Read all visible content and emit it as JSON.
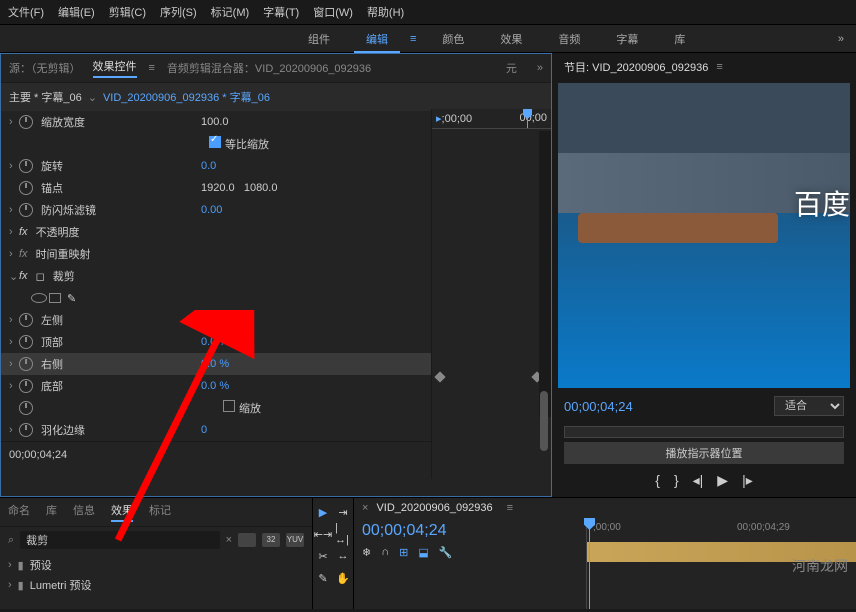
{
  "menu": {
    "file": "文件(F)",
    "edit": "编辑(E)",
    "clip": "剪辑(C)",
    "sequence": "序列(S)",
    "mark": "标记(M)",
    "subtitle": "字幕(T)",
    "window": "窗口(W)",
    "help": "帮助(H)"
  },
  "tabs": {
    "component": "组件",
    "edit": "编辑",
    "color": "颜色",
    "effect": "效果",
    "audio": "音频",
    "subtitle": "字幕",
    "library": "库",
    "more": "»"
  },
  "source_tabs": {
    "source": "源：（无剪辑）",
    "effect_controls": "效果控件",
    "audio_mixer": "音频剪辑混合器：VID_20200906_092936",
    "yuan": "元",
    "more": "»"
  },
  "breadcrumb": {
    "main": "主要 * 字幕_06",
    "clip": "VID_20200906_092936 * 字幕_06"
  },
  "timeline_head": {
    "start": ";00;00",
    "end": "00;00"
  },
  "props": {
    "scale_width": {
      "label": "缩放宽度",
      "value": "100.0"
    },
    "uniform": {
      "label": "等比缩放"
    },
    "rotation": {
      "label": "旋转",
      "value": "0.0"
    },
    "anchor": {
      "label": "锚点",
      "x": "1920.0",
      "y": "1080.0"
    },
    "flicker": {
      "label": "防闪烁滤镜",
      "value": "0.00"
    },
    "opacity": {
      "label": "不透明度"
    },
    "time_remap": {
      "label": "时间重映射"
    },
    "crop": {
      "label": "裁剪"
    },
    "left": {
      "label": "左侧",
      "value": "0.0 %"
    },
    "top": {
      "label": "顶部",
      "value": "0.0 %"
    },
    "right": {
      "label": "右侧",
      "value": "0.0 %"
    },
    "bottom": {
      "label": "底部",
      "value": "0.0 %"
    },
    "zoom": {
      "label": "缩放"
    },
    "feather": {
      "label": "羽化边缘",
      "value": "0"
    }
  },
  "reset_icon": "↺",
  "timecode": "00;00;04;24",
  "program": {
    "label": "节目: VID_20200906_092936",
    "overlay": "百度",
    "tc": "00;00;04;24",
    "fit": "适合",
    "scrub_label": "播放指示器位置"
  },
  "bottom_tabs": {
    "name": "命名",
    "lib": "库",
    "info": "信息",
    "effects": "效果",
    "mark": "标记"
  },
  "search": {
    "placeholder": "",
    "value": "裁剪"
  },
  "folders": {
    "preset": "预设",
    "lumetri": "Lumetri 预设"
  },
  "timeline": {
    "name": "VID_20200906_092936",
    "tc": "00;00;04;24",
    "r1": ";00;00",
    "r2": "00;00;04;29"
  },
  "watermark": "河南龙网"
}
